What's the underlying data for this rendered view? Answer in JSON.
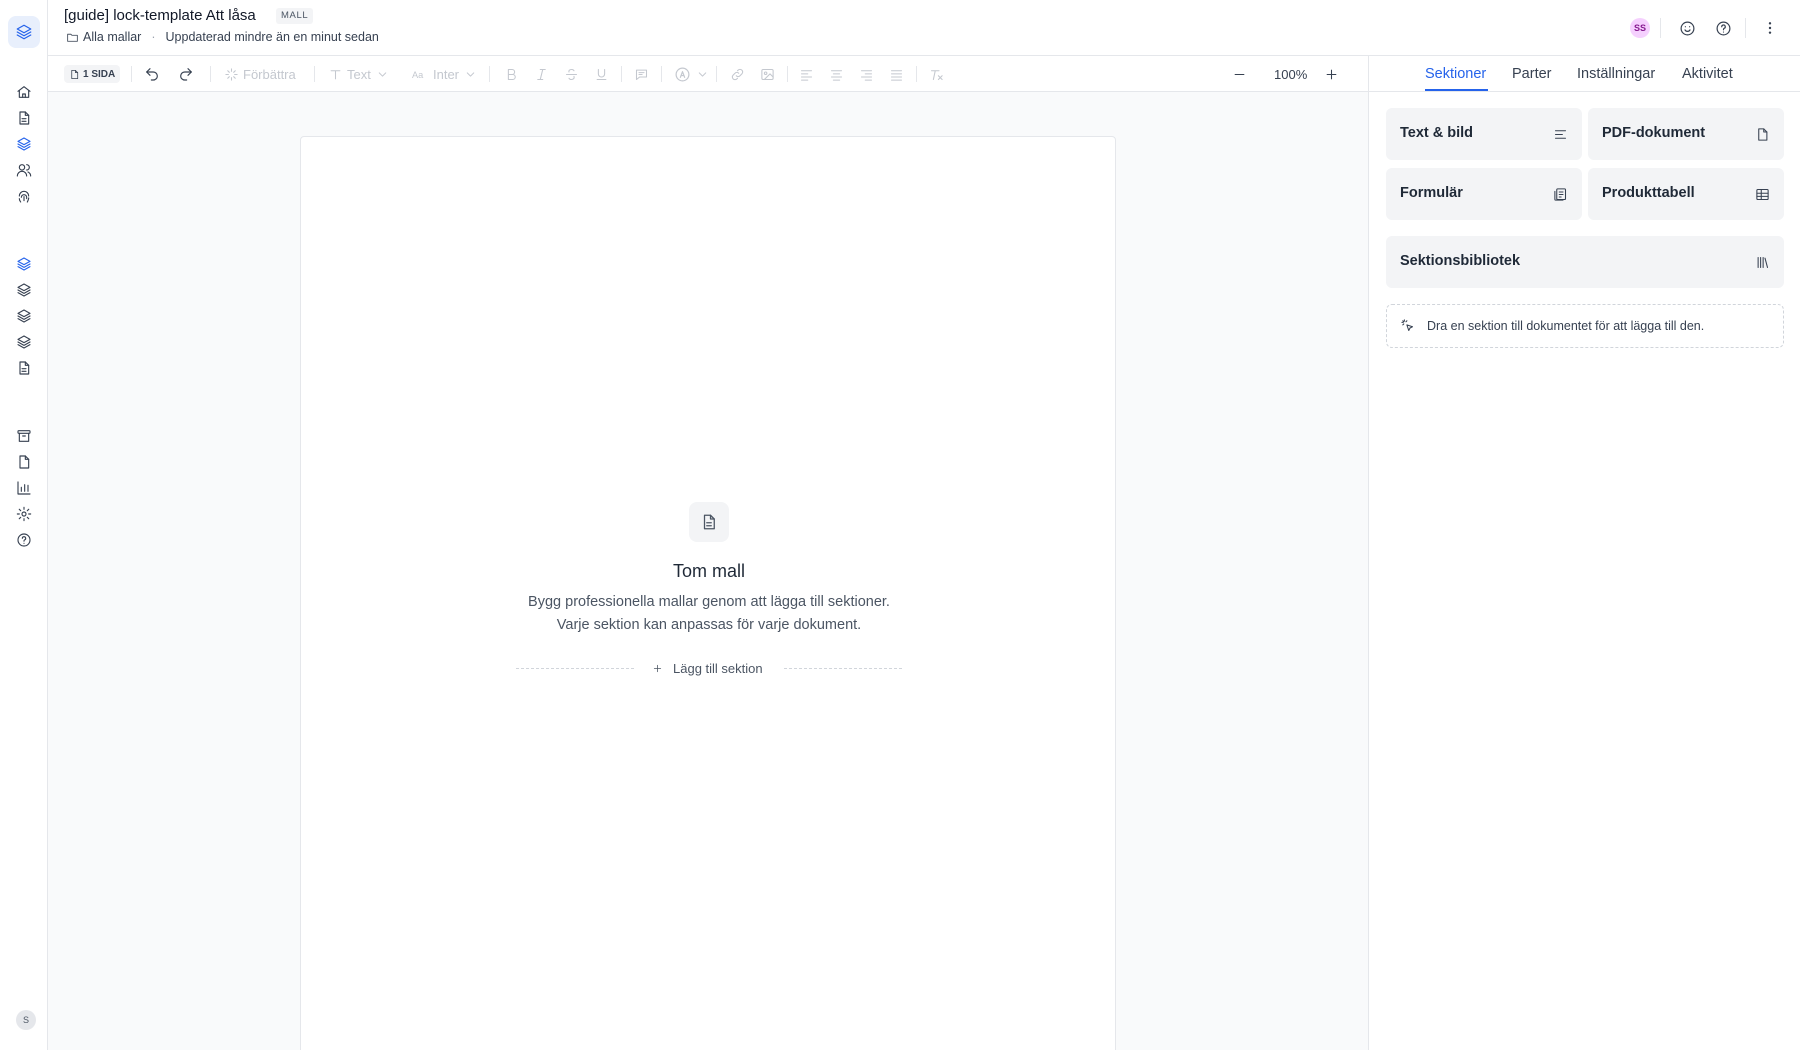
{
  "header": {
    "title": "[guide] lock-template Att låsa",
    "badge": "MALL",
    "breadcrumb_folder": "Alla mallar",
    "updated": "Uppdaterad mindre än en minut sedan",
    "user_initials": "SS"
  },
  "rail": {
    "logo_icon": "layers-icon",
    "nav_icons": [
      "home-icon",
      "document-icon",
      "layers-icon",
      "contacts-icon",
      "fingerprint-icon"
    ],
    "template_icons": [
      "layers-icon",
      "layers-icon",
      "layers-icon",
      "layers-icon",
      "document-icon"
    ],
    "bottom_icons": [
      "archive-icon",
      "file-icon",
      "bar-chart-icon",
      "gear-icon",
      "help-icon"
    ],
    "user_initial": "S"
  },
  "toolbar": {
    "pages_label": "1 SIDA",
    "improve_label": "Förbättra",
    "text_style_label": "Text",
    "font_label": "Inter",
    "zoom": "100%"
  },
  "canvas": {
    "empty_title": "Tom mall",
    "empty_desc_line1": "Bygg professionella mallar genom att lägga till sektioner.",
    "empty_desc_line2": "Varje sektion kan anpassas för varje dokument.",
    "add_section_label": "Lägg till sektion"
  },
  "panel": {
    "tabs": [
      {
        "label": "Sektioner",
        "active": true
      },
      {
        "label": "Parter",
        "active": false
      },
      {
        "label": "Inställningar",
        "active": false
      },
      {
        "label": "Aktivitet",
        "active": false
      }
    ],
    "cards": [
      {
        "label": "Text & bild",
        "icon": "align-left-icon"
      },
      {
        "label": "PDF-dokument",
        "icon": "file-icon"
      },
      {
        "label": "Formulär",
        "icon": "form-icon"
      },
      {
        "label": "Produkttabell",
        "icon": "table-icon"
      },
      {
        "label": "Sektionsbibliotek",
        "icon": "library-icon"
      }
    ],
    "hint": "Dra en sektion till dokumentet för att lägga till den."
  },
  "colors": {
    "accent": "#2563eb",
    "canvas_bg": "#f9fafb",
    "card_bg": "#f3f4f6",
    "avatar_bg": "#f5d0fe"
  }
}
